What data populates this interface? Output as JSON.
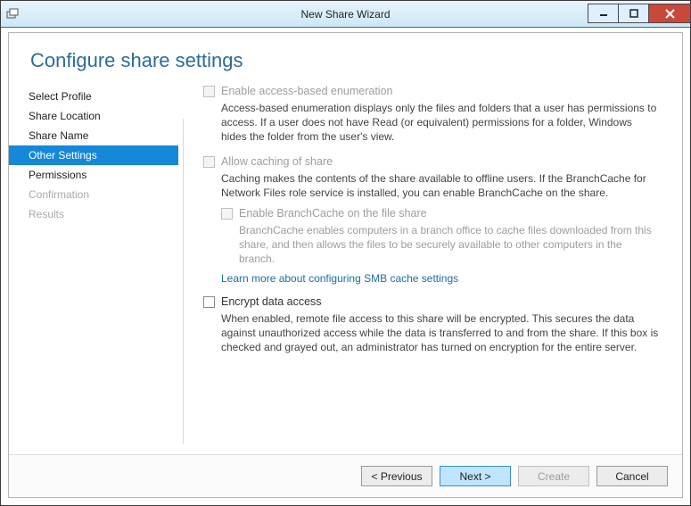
{
  "window": {
    "title": "New Share Wizard"
  },
  "heading": "Configure share settings",
  "nav": {
    "items": [
      {
        "label": "Select Profile"
      },
      {
        "label": "Share Location"
      },
      {
        "label": "Share Name"
      },
      {
        "label": "Other Settings"
      },
      {
        "label": "Permissions"
      },
      {
        "label": "Confirmation"
      },
      {
        "label": "Results"
      }
    ]
  },
  "options": {
    "abe": {
      "label": "Enable access-based enumeration",
      "desc": "Access-based enumeration displays only the files and folders that a user has permissions to access. If a user does not have Read (or equivalent) permissions for a folder, Windows hides the folder from the user's view."
    },
    "cache": {
      "label": "Allow caching of share",
      "desc": "Caching makes the contents of the share available to offline users. If the BranchCache for Network Files role service is installed, you can enable BranchCache on the share.",
      "branch": {
        "label": "Enable BranchCache on the file share",
        "desc": "BranchCache enables computers in a branch office to cache files downloaded from this share, and then allows the files to be securely available to other computers in the branch."
      },
      "link": "Learn more about configuring SMB cache settings"
    },
    "encrypt": {
      "label": "Encrypt data access",
      "desc": "When enabled, remote file access to this share will be encrypted. This secures the data against unauthorized access while the data is transferred to and from the share. If this box is checked and grayed out, an administrator has turned on encryption for the entire server."
    }
  },
  "footer": {
    "previous": "< Previous",
    "next": "Next >",
    "create": "Create",
    "cancel": "Cancel"
  }
}
